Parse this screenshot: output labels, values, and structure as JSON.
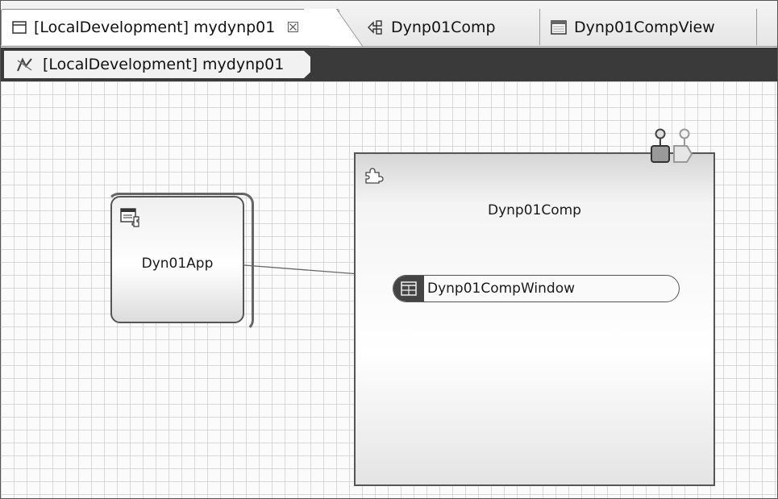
{
  "tabs": [
    {
      "label": "[LocalDevelopment] mydynp01",
      "icon": "editor-window-icon",
      "active": true,
      "closable": true
    },
    {
      "label": "Dynp01Comp",
      "icon": "component-icon",
      "active": false
    },
    {
      "label": "Dynp01CompView",
      "icon": "view-icon",
      "active": false
    }
  ],
  "tab_close_glyph": "☒",
  "breadcrumb": {
    "label": "[LocalDevelopment] mydynp01",
    "icon": "diagram-icon"
  },
  "diagram": {
    "app_node": {
      "label": "Dyn01App",
      "icon": "application-icon"
    },
    "component_node": {
      "label": "Dynp01Comp",
      "icon": "puzzle-icon"
    },
    "window_node": {
      "label": "Dynp01CompWindow",
      "icon": "window-icon"
    }
  },
  "colors": {
    "dark_bar": "#3a3a3a",
    "grid": "#d8d8d8",
    "border": "#555555"
  }
}
